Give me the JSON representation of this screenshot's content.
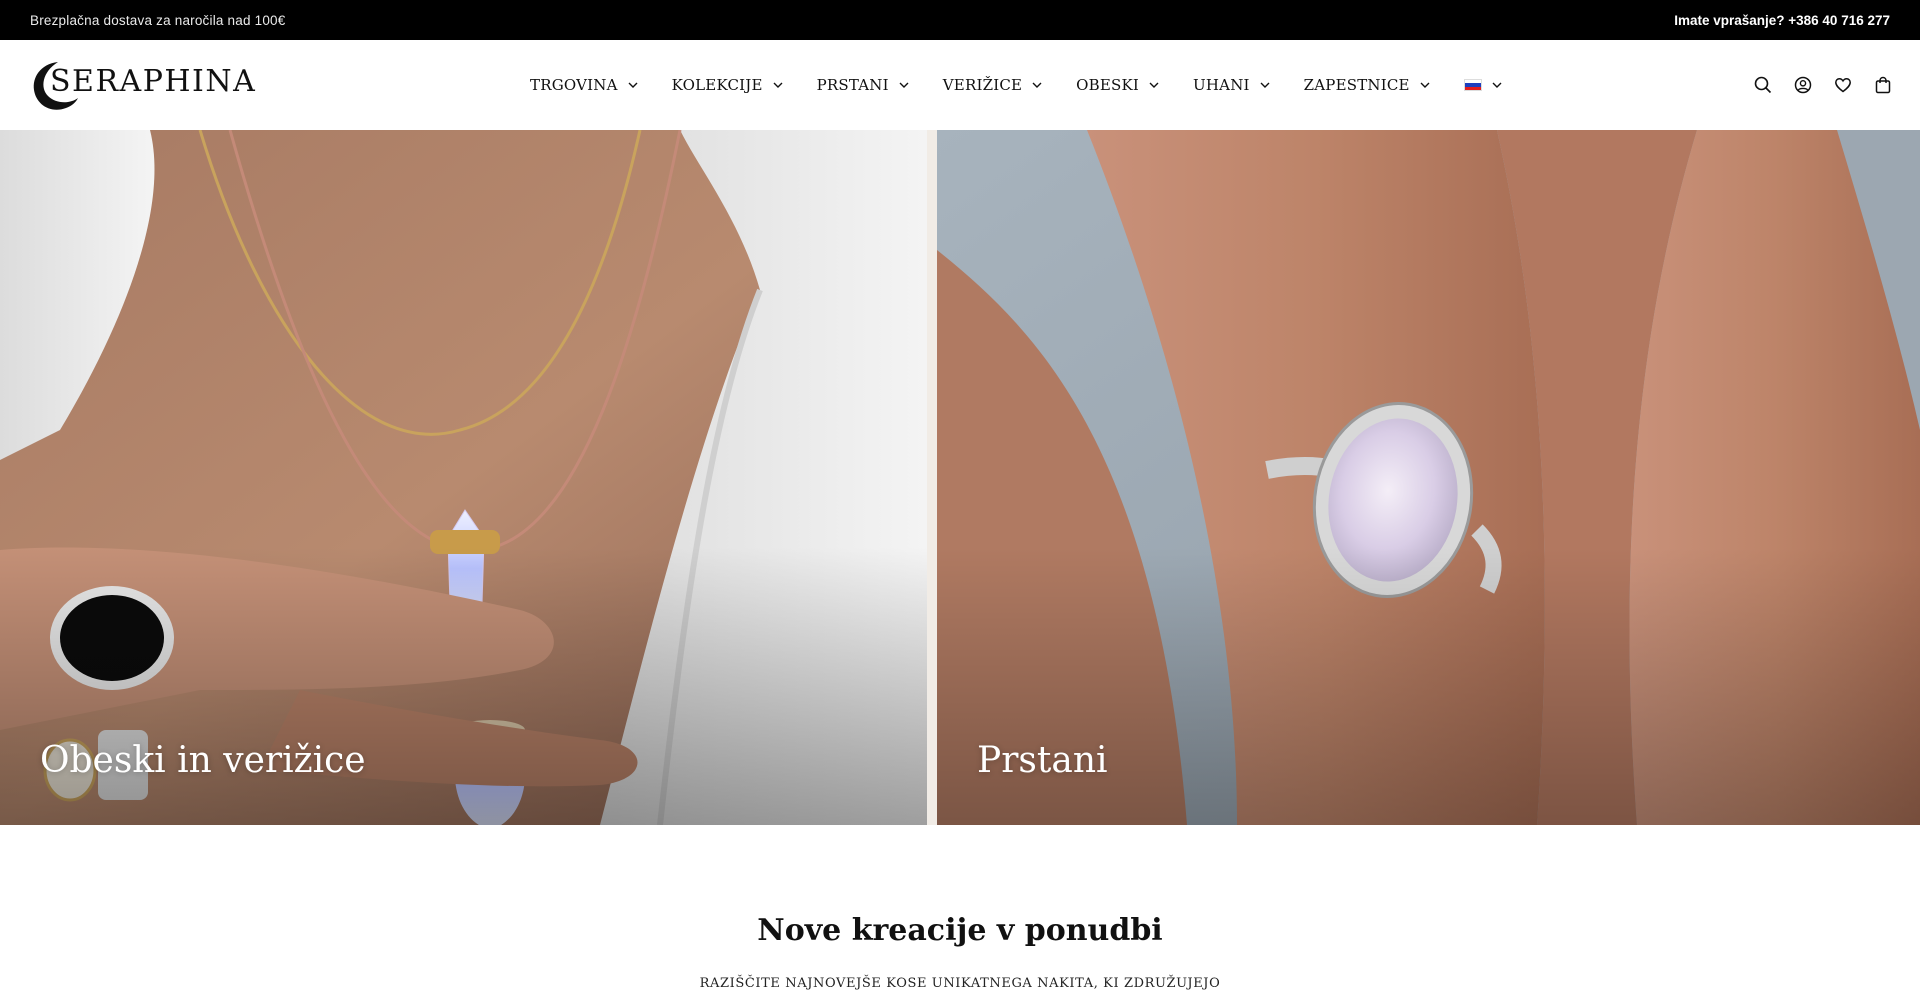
{
  "announcement": {
    "left_text": "Brezplačna dostava za naročila nad 100€",
    "right_text": "Imate vprašanje? +386 40 716 277"
  },
  "brand": {
    "name": "SERAPHINA"
  },
  "nav": {
    "items": [
      {
        "label": "TRGOVINA",
        "icon": "chevron-down-icon"
      },
      {
        "label": "KOLEKCIJE",
        "icon": "chevron-down-icon"
      },
      {
        "label": "PRSTANI",
        "icon": "chevron-down-icon"
      },
      {
        "label": "VERIŽICE",
        "icon": "chevron-down-icon"
      },
      {
        "label": "OBESKI",
        "icon": "chevron-down-icon"
      },
      {
        "label": "UHANI",
        "icon": "chevron-down-icon"
      },
      {
        "label": "ZAPESTNICE",
        "icon": "chevron-down-icon"
      }
    ],
    "language": {
      "icon": "slovenia-flag-icon",
      "colors": [
        "#ffffff",
        "#0000ff",
        "#ff0000"
      ]
    }
  },
  "header_icons": [
    "search-icon",
    "account-icon",
    "wishlist-heart-icon",
    "cart-bag-icon"
  ],
  "hero": {
    "left": {
      "title": "Obeski in verižice",
      "image": "necklace-pendants-photo"
    },
    "right": {
      "title": "Prstani",
      "image": "moonstone-ring-on-hand-photo"
    }
  },
  "section": {
    "title": "Nove kreacije v ponudbi",
    "subtitle": "RAZIŠČITE NAJNOVEJŠE KOSE UNIKATNEGA NAKITA, KI ZDRUŽUJEJO"
  },
  "colors": {
    "announcement_bg": "#000000",
    "text": "#111111",
    "background": "#ffffff"
  }
}
